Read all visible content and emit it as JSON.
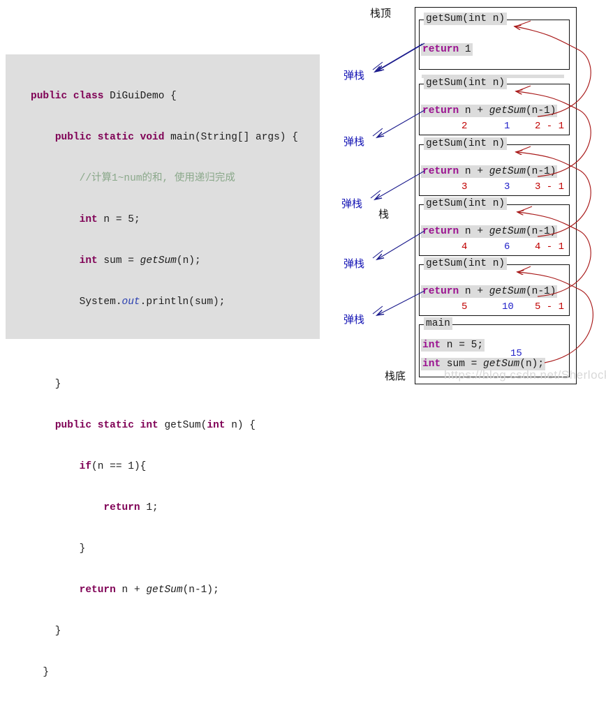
{
  "code": {
    "language": "java",
    "lines": [
      "public class DiGuiDemo {",
      "    public static void main(String[] args) {",
      "        //计算1~num的和, 使用递归完成",
      "        int n = 5;",
      "        int sum = getSum(n);",
      "        System.out.println(sum);",
      "",
      "    }",
      "    public static int getSum(int n) {",
      "        if(n == 1){",
      "            return 1;",
      "        }",
      "        return n + getSum(n-1);",
      "    }",
      "}"
    ]
  },
  "diagram": {
    "labels": {
      "stack_top": "栈顶",
      "stack_bottom": "栈底",
      "stack": "栈",
      "pop": "弹栈"
    },
    "frames": [
      {
        "title": "getSum(int n)",
        "statement": "return 1",
        "values": null
      },
      {
        "title": "getSum(int n)",
        "statement": "return n + getSum(n-1)",
        "values": {
          "n": "2",
          "result": "1",
          "arg": "2 - 1"
        }
      },
      {
        "title": "getSum(int n)",
        "statement": "return n + getSum(n-1)",
        "values": {
          "n": "3",
          "result": "3",
          "arg": "3 - 1"
        }
      },
      {
        "title": "getSum(int n)",
        "statement": "return n + getSum(n-1)",
        "values": {
          "n": "4",
          "result": "6",
          "arg": "4 - 1"
        }
      },
      {
        "title": "getSum(int n)",
        "statement": "return n + getSum(n-1)",
        "values": {
          "n": "5",
          "result": "10",
          "arg": "5 - 1"
        }
      },
      {
        "title": "main",
        "statement_1": "int n = 5;",
        "statement_2": "int sum = getSum(n);",
        "values": {
          "result": "15"
        }
      }
    ],
    "colors": {
      "call_arrow": "#a81818",
      "pop_arrow": "#1a1a8c",
      "frame_border": "#111111",
      "title_bg": "#dcdcdc",
      "code_bg": "#dedede",
      "value_red": "#c00000",
      "value_blue": "#2020c8"
    }
  },
  "watermark": "https://blog.csdn.net/Sherlock_me"
}
